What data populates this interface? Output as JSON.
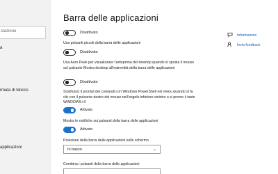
{
  "sidebar": {
    "search_partial": "stazione",
    "items": [
      {
        "id": "a",
        "label": "a"
      },
      {
        "id": "blocco",
        "label": "rmata di blocco"
      },
      {
        "id": "applicazioni",
        "label": "applicazioni"
      }
    ]
  },
  "page": {
    "title": "Barra delle applicazioni"
  },
  "settings": {
    "lock_taskbar": {
      "state": "Disattivato"
    },
    "small_buttons": {
      "label": "Usa pulsanti piccoli della barra delle applicazioni",
      "state": "Disattivato"
    },
    "aero_peek": {
      "label": "Usa Aero Peek per visualizzare l'anteprima del desktop quando si sposta il mouse sul pulsante Mostra desktop all'estremità della barra delle applicazioni",
      "state": "Disattivato"
    },
    "powershell": {
      "label": "Sostituisci il prompt dei comandi con Windows PowerShell nel menu quando si fa clic con il pulsante destro del mouse nell'angolo inferiore sinistro o si preme il tasto WINDOWS+X",
      "state": "Attivato"
    },
    "badges": {
      "label": "Mostra le notifiche sui pulsanti della barra delle applicazioni",
      "state": "Attivato"
    },
    "position": {
      "label": "Posizione della barra delle applicazioni sullo schermo",
      "value": "In basso"
    },
    "combine": {
      "label": "Combina i pulsanti della barra delle applicazioni"
    }
  },
  "right_links": {
    "info": "Informazioni",
    "feedback": "Invia feedback"
  },
  "colors": {
    "accent": "#1a73c9",
    "link": "#1a5fb4",
    "sidebar_bg": "#f2f2f2"
  }
}
